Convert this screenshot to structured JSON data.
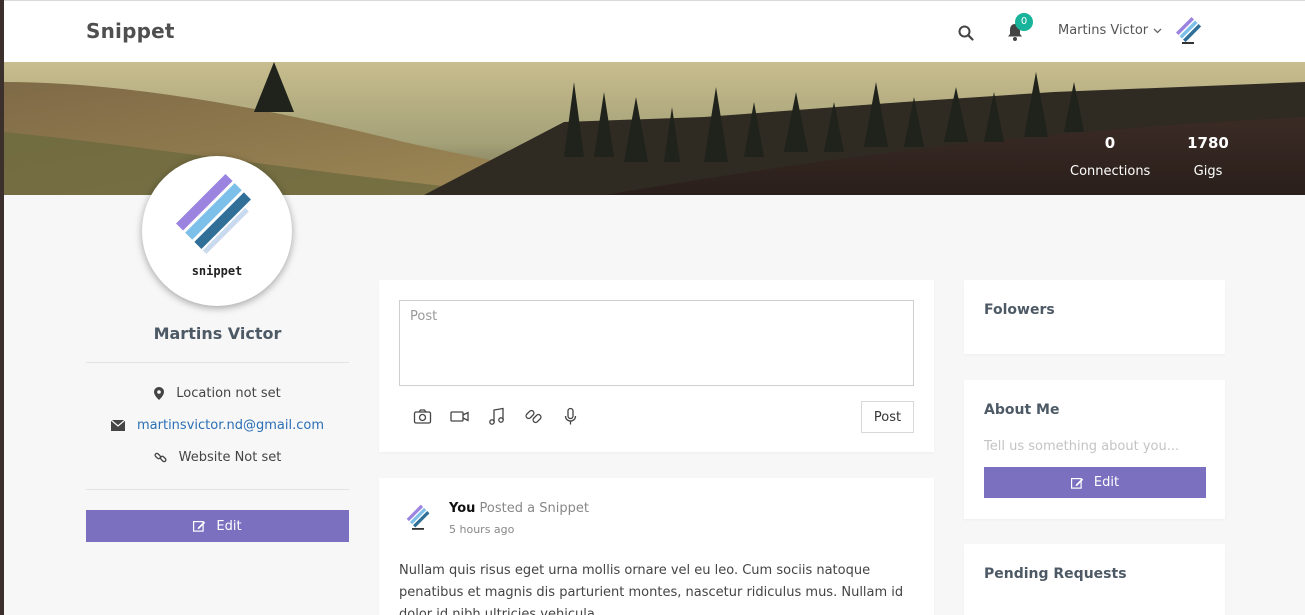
{
  "navbar": {
    "brand": "Snippet",
    "notifications_count": "0",
    "user_name": "Martins Victor"
  },
  "cover": {
    "stats": [
      {
        "value": "0",
        "label": "Connections"
      },
      {
        "value": "1780",
        "label": "Gigs"
      }
    ]
  },
  "profile": {
    "logo_word": "snippet",
    "name": "Martins Victor",
    "location": "Location not set",
    "email": "martinsvictor.nd@gmail.com",
    "website": "Website Not set",
    "edit_label": "Edit"
  },
  "composer": {
    "placeholder": "Post",
    "post_label": "Post",
    "media_icons": [
      "camera-icon",
      "video-icon",
      "music-icon",
      "link-icon",
      "microphone-icon"
    ]
  },
  "feed": {
    "author": "You",
    "action": "Posted a Snippet",
    "time": "5 hours ago",
    "text": "Nullam quis risus eget urna mollis ornare vel eu leo. Cum sociis natoque penatibus et magnis dis parturient montes, nascetur ridiculus mus. Nullam id dolor id nibh ultricies vehicula."
  },
  "sidebar": {
    "followers_title": "Folowers",
    "about_title": "About Me",
    "about_placeholder": "Tell us something about you...",
    "about_edit_label": "Edit",
    "pending_title": "Pending Requests"
  },
  "colors": {
    "accent": "#7b6fbf",
    "badge": "#17b39a",
    "link": "#2b6fb5"
  }
}
